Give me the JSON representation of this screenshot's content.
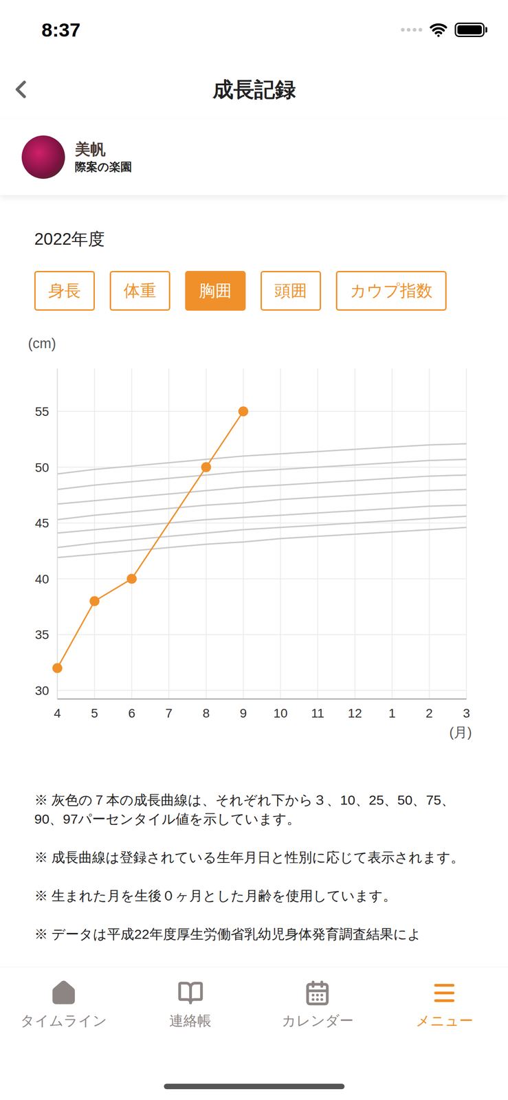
{
  "status_bar": {
    "time": "8:37"
  },
  "nav": {
    "title": "成長記録"
  },
  "profile": {
    "name": "美帆",
    "school": "際案の楽園"
  },
  "year": "2022年度",
  "tabs": [
    {
      "label": "身長",
      "selected": false
    },
    {
      "label": "体重",
      "selected": false
    },
    {
      "label": "胸囲",
      "selected": true
    },
    {
      "label": "頭囲",
      "selected": false
    },
    {
      "label": "カウプ指数",
      "selected": false
    }
  ],
  "chart": {
    "unit": "(cm)",
    "x_unit": "(月)",
    "y_ticks": [
      "55",
      "50",
      "45",
      "40",
      "35",
      "30"
    ],
    "x_ticks": [
      "4",
      "5",
      "6",
      "7",
      "8",
      "9",
      "10",
      "11",
      "12",
      "1",
      "2",
      "3"
    ],
    "series": [
      {
        "values": [
          32,
          38,
          40,
          null,
          50,
          55,
          null,
          null,
          null,
          null,
          null,
          null
        ],
        "color": "#f0902a"
      }
    ],
    "reference_curves": [
      [
        41.9,
        42.2,
        42.5,
        42.8,
        43.1,
        43.3,
        43.6,
        43.8,
        44.0,
        44.2,
        44.4,
        44.6
      ],
      [
        42.8,
        43.2,
        43.5,
        43.8,
        44.1,
        44.4,
        44.6,
        44.8,
        45.0,
        45.2,
        45.4,
        45.6
      ],
      [
        44.1,
        44.4,
        44.7,
        45.0,
        45.3,
        45.5,
        45.7,
        45.9,
        46.1,
        46.3,
        46.5,
        46.6
      ],
      [
        45.3,
        45.7,
        46.0,
        46.3,
        46.6,
        46.8,
        47.1,
        47.3,
        47.5,
        47.7,
        47.9,
        48.0
      ],
      [
        46.7,
        47.0,
        47.3,
        47.6,
        47.9,
        48.2,
        48.4,
        48.6,
        48.8,
        49.0,
        49.2,
        49.3
      ],
      [
        48.0,
        48.4,
        48.7,
        49.0,
        49.3,
        49.6,
        49.8,
        50.0,
        50.2,
        50.4,
        50.6,
        50.7
      ],
      [
        49.4,
        49.8,
        50.1,
        50.4,
        50.7,
        51.0,
        51.2,
        51.4,
        51.6,
        51.8,
        52.0,
        52.1
      ]
    ]
  },
  "notes": [
    "※ 灰色の７本の成長曲線は、それぞれ下から３、10、25、50、75、90、97パーセンタイル値を示しています。",
    "※ 成長曲線は登録されている生年月日と性別に応じて表示されます。",
    "※ 生まれた月を生後０ヶ月とした月齢を使用しています。",
    "※ データは平成22年度厚生労働省乳幼児身体発育調査結果によ"
  ],
  "tab_bar": [
    {
      "label": "タイムライン",
      "selected": false
    },
    {
      "label": "連絡帳",
      "selected": false
    },
    {
      "label": "カレンダー",
      "selected": false
    },
    {
      "label": "メニュー",
      "selected": true
    }
  ]
}
